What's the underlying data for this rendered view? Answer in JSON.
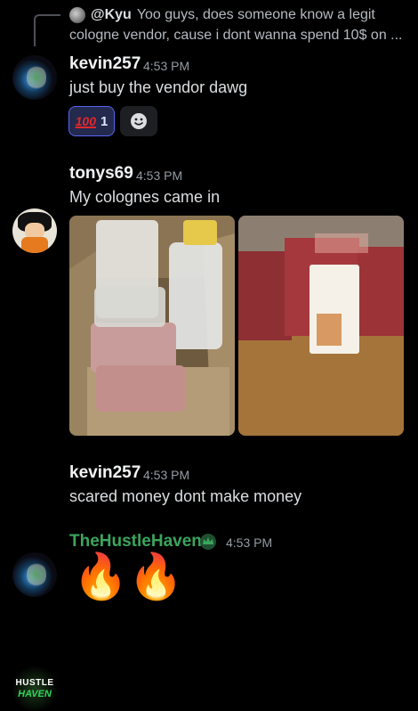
{
  "reply": {
    "username": "@Kyu",
    "text_line1": "Yoo guys, does someone know a legit",
    "text_line2": "cologne vendor, cause i dont wanna spend 10$ on ..."
  },
  "messages": [
    {
      "username": "kevin257",
      "timestamp": "4:53 PM",
      "text": "just buy the vendor dawg",
      "reaction": {
        "emoji": "100",
        "count": "1"
      }
    },
    {
      "username": "tonys69",
      "timestamp": "4:53 PM",
      "text": "My colognes came in",
      "attachments": [
        "package-photo",
        "cologne-photo"
      ]
    },
    {
      "username": "kevin257",
      "timestamp": "4:53 PM",
      "text": "scared money dont make money"
    },
    {
      "username": "TheHustleHaven",
      "timestamp": "4:53 PM",
      "text": "🔥🔥",
      "avatar_text_top": "HUSTLE",
      "avatar_text_bottom": "HAVEN"
    }
  ],
  "colors": {
    "background": "#000000",
    "role_green": "#3ba55d",
    "reaction_bg": "#232a4d",
    "reaction_border": "#5865f2"
  }
}
